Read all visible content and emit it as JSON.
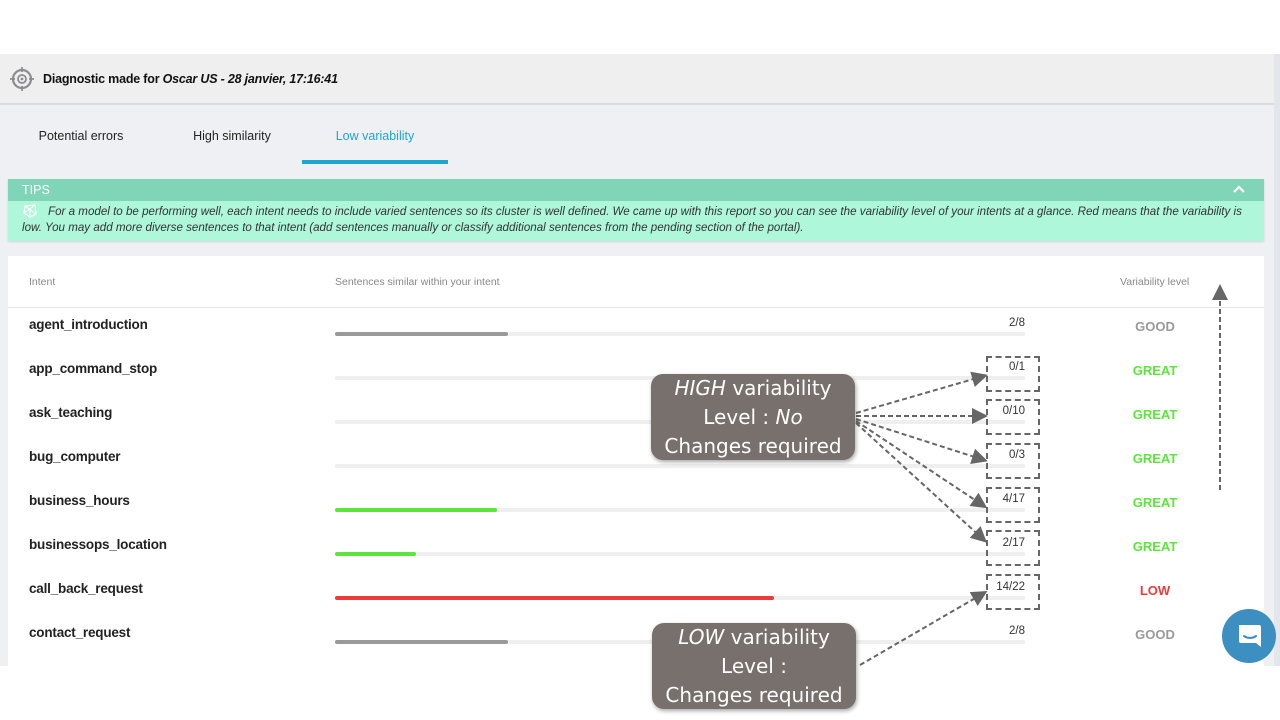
{
  "header": {
    "prefix": "Diagnostic made for",
    "target": "Oscar US - 28 janvier, 17:16:41",
    "icon": "crosshair-icon"
  },
  "tabs": [
    {
      "label": "Potential errors",
      "active": false
    },
    {
      "label": "High similarity",
      "active": false
    },
    {
      "label": "Low variability",
      "active": true
    }
  ],
  "tips": {
    "title": "TIPS",
    "text": "For a model to be performing well, each intent needs to include varied sentences so its cluster is well defined. We came up with this report so you can see the variability level of your intents at a glance. Red means that the variability is low. You may add more diverse sentences to that intent (add sentences manually or classify additional sentences from the pending section of the portal).",
    "collapse_icon": "chevron-up-icon"
  },
  "table": {
    "columns": {
      "intent": "Intent",
      "sentences": "Sentences similar within your intent",
      "level": "Variability level"
    },
    "rows": [
      {
        "intent": "agent_introduction",
        "similar": 2,
        "total": 8,
        "count": "2/8",
        "level": "GOOD",
        "color": "#999999"
      },
      {
        "intent": "app_command_stop",
        "similar": 0,
        "total": 1,
        "count": "0/1",
        "level": "GREAT",
        "color": "#5ce63c"
      },
      {
        "intent": "ask_teaching",
        "similar": 0,
        "total": 10,
        "count": "0/10",
        "level": "GREAT",
        "color": "#5ce63c"
      },
      {
        "intent": "bug_computer",
        "similar": 0,
        "total": 3,
        "count": "0/3",
        "level": "GREAT",
        "color": "#5ce63c"
      },
      {
        "intent": "business_hours",
        "similar": 4,
        "total": 17,
        "count": "4/17",
        "level": "GREAT",
        "color": "#5ce63c"
      },
      {
        "intent": "businessops_location",
        "similar": 2,
        "total": 17,
        "count": "2/17",
        "level": "GREAT",
        "color": "#5ce63c"
      },
      {
        "intent": "call_back_request",
        "similar": 14,
        "total": 22,
        "count": "14/22",
        "level": "LOW",
        "color": "#ee3a3a"
      },
      {
        "intent": "contact_request",
        "similar": 2,
        "total": 8,
        "count": "2/8",
        "level": "GOOD",
        "color": "#999999"
      }
    ]
  },
  "annotations": {
    "high": {
      "em": "HIGH",
      "line1_rest": " variability",
      "line2": "Level : ",
      "line2_em": "No",
      "line3": "Changes required"
    },
    "low": {
      "em": "LOW",
      "line1_rest": " variability",
      "line2": "Level :",
      "line2_em": "",
      "line3": "Changes required"
    }
  },
  "chat": {
    "icon": "chat-icon"
  }
}
